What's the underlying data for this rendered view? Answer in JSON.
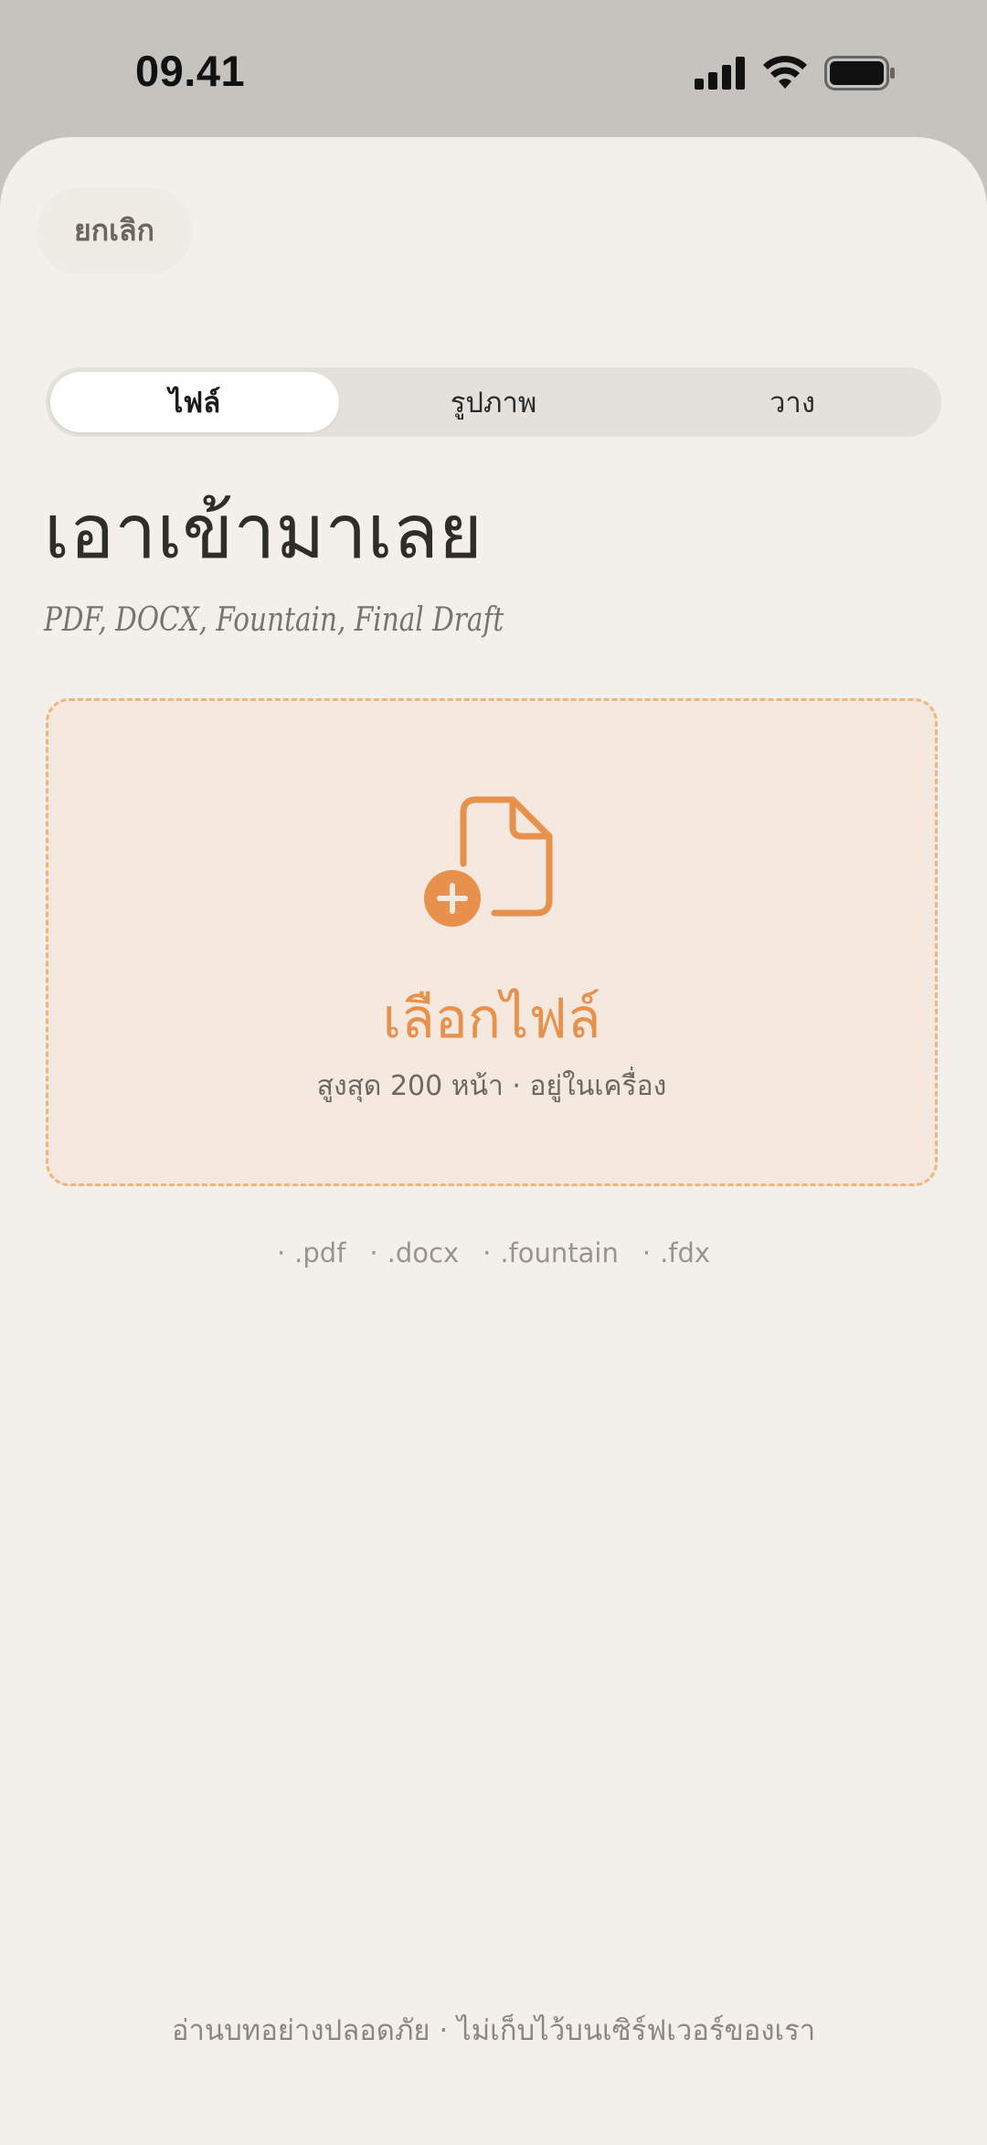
{
  "status_bar": {
    "time": "09.41",
    "icons": [
      "signal-icon",
      "wifi-icon",
      "battery-icon"
    ]
  },
  "header": {
    "cancel_label": "ยกเลิก"
  },
  "tabs": [
    {
      "label": "ไฟล์",
      "active": true
    },
    {
      "label": "รูปภาพ",
      "active": false
    },
    {
      "label": "วาง",
      "active": false
    }
  ],
  "main": {
    "title": "เอาเข้ามาเลย",
    "subtitle": "PDF, DOCX, Fountain, Final Draft"
  },
  "dropzone": {
    "icon": "document-add-icon",
    "title": "เลือกไฟล์",
    "subtitle": "สูงสุด 200 หน้า · อยู่ในเครื่อง"
  },
  "formats": [
    ".pdf",
    ".docx",
    ".fountain",
    ".fdx"
  ],
  "format_bullet": "·",
  "footer": {
    "note": "อ่านบทอย่างปลอดภัย · ไม่เก็บไว้บนเซิร์ฟเวอร์ของเรา"
  },
  "colors": {
    "accent": "#e7914c",
    "dropzone_border": "#f0b47d",
    "dropzone_bg": "#f4e8df",
    "sheet_bg": "#f3f0eb",
    "backdrop": "#c4c3bd"
  }
}
